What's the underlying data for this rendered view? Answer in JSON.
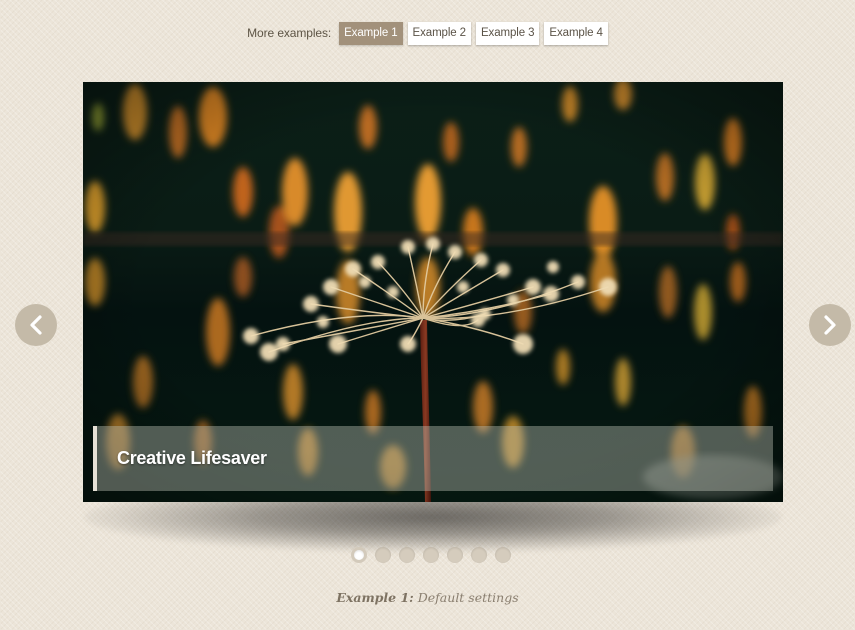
{
  "nav": {
    "label": "More examples:",
    "examples": [
      {
        "label": "Example 1",
        "active": true
      },
      {
        "label": "Example 2",
        "active": false
      },
      {
        "label": "Example 3",
        "active": false
      },
      {
        "label": "Example 4",
        "active": false
      }
    ]
  },
  "slider": {
    "caption": "Creative Lifesaver",
    "slide_count": 7,
    "current_slide": 1,
    "prev_icon": "chevron-left-icon",
    "next_icon": "chevron-right-icon"
  },
  "footer": {
    "title": "Example 1:",
    "description": "Default settings"
  },
  "colors": {
    "background": "#ece5d9",
    "active_button": "#a2917b",
    "arrow_button": "#c4baa8",
    "dot_inactive": "#d5ccbd"
  }
}
